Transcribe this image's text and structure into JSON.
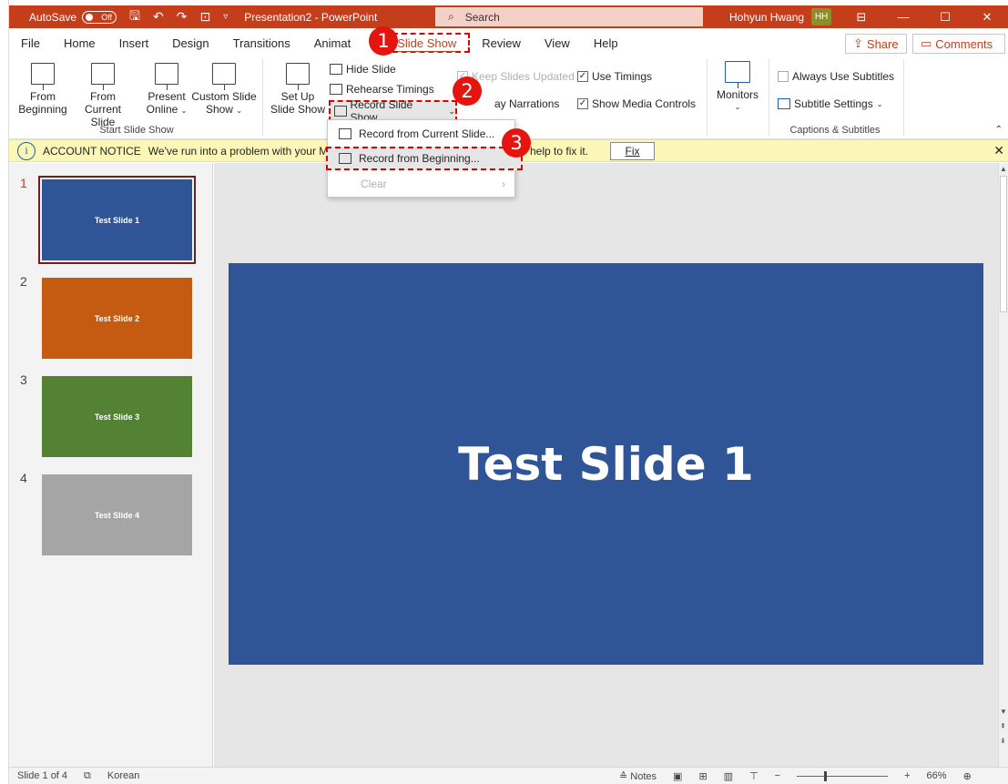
{
  "titlebar": {
    "autosave_label": "AutoSave",
    "autosave_state": "Off",
    "doc_title": "Presentation2  -  PowerPoint",
    "search_placeholder": "Search",
    "user_name": "Hohyun Hwang",
    "user_initials": "HH"
  },
  "menu": {
    "tabs": [
      "File",
      "Home",
      "Insert",
      "Design",
      "Transitions",
      "Animat",
      "Slide Show",
      "Review",
      "View",
      "Help"
    ],
    "active_tab": "Slide Show",
    "share_label": "Share",
    "comments_label": "Comments"
  },
  "ribbon": {
    "from_beginning": [
      "From",
      "Beginning"
    ],
    "from_current": [
      "From",
      "Current Slide"
    ],
    "present_online": [
      "Present",
      "Online"
    ],
    "custom_slide_show": [
      "Custom Slide",
      "Show"
    ],
    "start_group_label": "Start Slide Show",
    "set_up": [
      "Set Up",
      "Slide Show"
    ],
    "hide_slide": "Hide Slide",
    "rehearse_timings": "Rehearse Timings",
    "record_slide_show": "Record Slide Show",
    "keep_slides_updated": "Keep Slides Updated",
    "play_narrations": "ay Narrations",
    "use_timings": "Use Timings",
    "show_media_controls": "Show Media Controls",
    "monitors": "Monitors",
    "always_use_subtitles": "Always Use Subtitles",
    "subtitle_settings": "Subtitle Settings",
    "captions_group_label": "Captions & Subtitles"
  },
  "infobar": {
    "title": "ACCOUNT NOTICE",
    "message": "We've run into a problem with your Mi",
    "message_tail": "help to fix it.",
    "fix_label": "Fix"
  },
  "dropdown": {
    "items": [
      "Record from Current Slide...",
      "Record from Beginning...",
      "Clear"
    ]
  },
  "callouts": [
    "1",
    "2",
    "3"
  ],
  "slides": [
    {
      "num": "1",
      "label": "Test Slide 1",
      "color": "#2f5597"
    },
    {
      "num": "2",
      "label": "Test Slide 2",
      "color": "#c55a11"
    },
    {
      "num": "3",
      "label": "Test Slide 3",
      "color": "#548235"
    },
    {
      "num": "4",
      "label": "Test Slide 4",
      "color": "#a5a5a5"
    }
  ],
  "current_slide_title": "Test Slide 1",
  "statusbar": {
    "slide_info": "Slide 1 of 4",
    "language": "Korean",
    "notes_label": "Notes",
    "zoom": "66%"
  },
  "colors": {
    "accent": "#c43e1c",
    "callout": "#e5140f"
  }
}
